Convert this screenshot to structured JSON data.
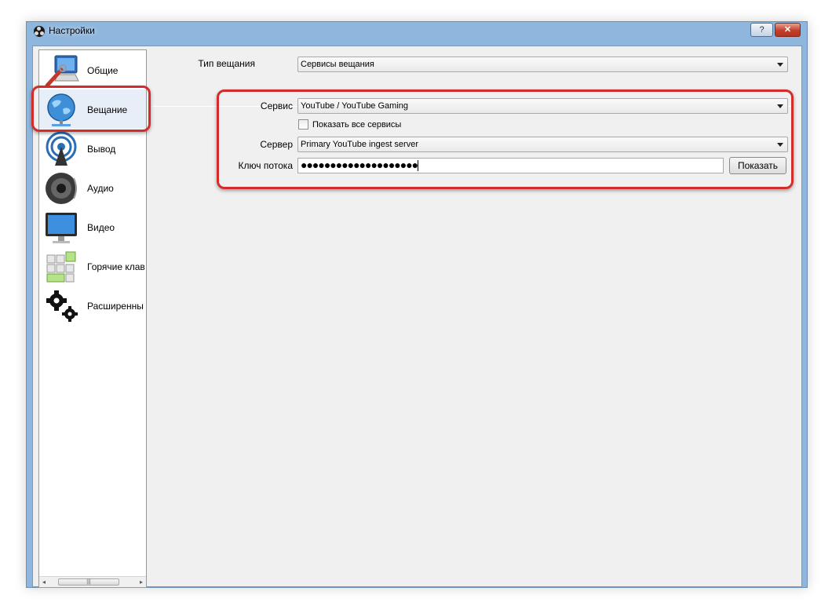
{
  "window": {
    "title": "Настройки",
    "help_label": "?",
    "close_label": "✕"
  },
  "sidebar": {
    "items": [
      {
        "label": "Общие",
        "icon": "computer-wrench-icon"
      },
      {
        "label": "Вещание",
        "icon": "globe-network-icon"
      },
      {
        "label": "Вывод",
        "icon": "broadcast-antenna-icon"
      },
      {
        "label": "Аудио",
        "icon": "speaker-icon"
      },
      {
        "label": "Видео",
        "icon": "monitor-icon"
      },
      {
        "label": "Горячие клав",
        "icon": "keyboard-keys-icon"
      },
      {
        "label": "Расширенны",
        "icon": "gears-icon"
      }
    ],
    "selected": "Вещание",
    "scroll_left": "◂",
    "scroll_right": "▸",
    "scroll_grip": "|||"
  },
  "stream": {
    "type_label": "Тип вещания",
    "type_value": "Сервисы вещания",
    "service_label": "Сервис",
    "service_value": "YouTube / YouTube Gaming",
    "show_all_label": "Показать все сервисы",
    "show_all_checked": false,
    "server_label": "Сервер",
    "server_value": "Primary YouTube ingest server",
    "key_label": "Ключ потока",
    "key_value": "●●●●●●●●●●●●●●●●●●●●",
    "show_button": "Показать"
  },
  "colors": {
    "highlight": "#d42b2b",
    "window_frame": "#8fb6dd"
  }
}
